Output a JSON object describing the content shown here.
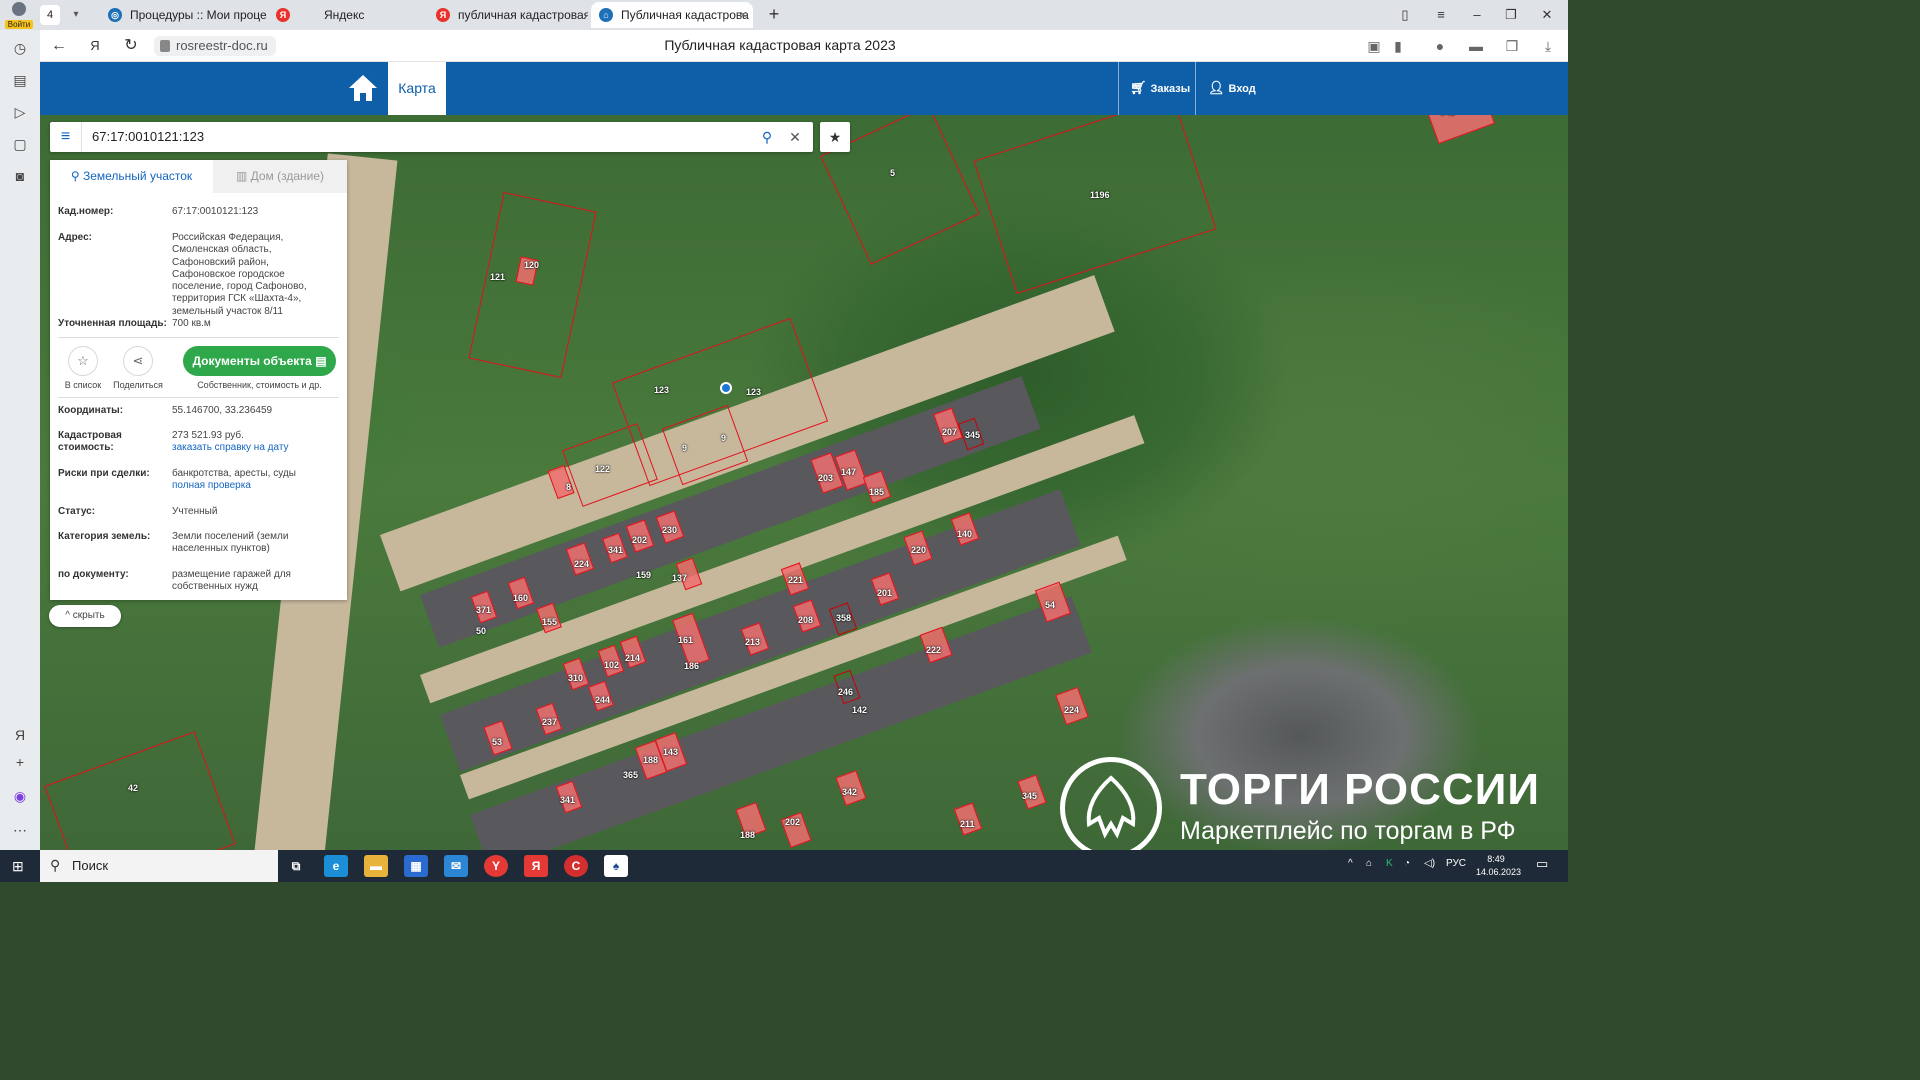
{
  "browser": {
    "profile_label": "Войти",
    "tab_count": "4",
    "tabs": [
      {
        "title": "Процедуры :: Мои проце",
        "active": false
      },
      {
        "title": "Яндекс",
        "active": false
      },
      {
        "title": "публичная кадастровая к",
        "active": false
      },
      {
        "title": "Публичная кадастрова",
        "active": true
      }
    ],
    "url": "rosreestr-doc.ru",
    "page_title": "Публичная кадастровая карта 2023"
  },
  "site": {
    "map_tab": "Карта",
    "orders": "Заказы",
    "login": "Вход"
  },
  "search": {
    "value": "67:17:0010121:123"
  },
  "panel": {
    "tab_land": "Земельный участок",
    "tab_house": "Дом (здание)",
    "fields": {
      "cad_label": "Кад.номер:",
      "cad_value": "67:17:0010121:123",
      "addr_label": "Адрес:",
      "addr_value": "Российская Федерация, Смоленская область, Сафоновский район, Сафоновское городское поселение, город Сафоново, территория ГСК «Шахта-4», земельный участок 8/11",
      "area_label": "Уточненная площадь:",
      "area_value": "700 кв.м",
      "coord_label": "Координаты:",
      "coord_value": "55.146700, 33.236459",
      "cost_label": "Кадастровая стоимость:",
      "cost_value": "273 521.93 руб.",
      "cost_link": "заказать справку на дату",
      "risk_label": "Риски при сделки:",
      "risk_value": "банкротства, аресты, суды",
      "risk_link": "полная проверка",
      "status_label": "Статус:",
      "status_value": "Учтенный",
      "cat_label": "Категория земель:",
      "cat_value": "Земли поселений (земли населенных пунктов)",
      "doc_label": "по документу:",
      "doc_value": "размещение гаражей для собственных нужд"
    },
    "actions": {
      "to_list": "В список",
      "share": "Поделиться",
      "docs_button": "Документы объекта",
      "docs_caption": "Собственник, стоимость и др."
    },
    "hide": "скрыть"
  },
  "map": {
    "parcel_labels": [
      "5",
      "1196",
      "121",
      "120",
      "123",
      "123",
      "9",
      "9",
      "122",
      "8",
      "42",
      "207",
      "345",
      "203",
      "147",
      "185",
      "220",
      "140",
      "221",
      "201",
      "54",
      "208",
      "358",
      "213",
      "222",
      "246",
      "142",
      "224",
      "224",
      "202",
      "230",
      "341",
      "159",
      "137",
      "371",
      "160",
      "155",
      "50",
      "161",
      "186",
      "102",
      "214",
      "310",
      "244",
      "237",
      "53",
      "188",
      "143",
      "365",
      "341",
      "342",
      "345",
      "188",
      "202",
      "211",
      "342"
    ]
  },
  "watermark": {
    "title": "ТОРГИ РОССИИ",
    "subtitle": "Маркетплейс по торгам в РФ"
  },
  "taskbar": {
    "search": "Поиск",
    "lang": "РУС",
    "time": "8:49",
    "date": "14.06.2023"
  },
  "colors": {
    "header_blue": "#0f5ea8",
    "link_blue": "#1565c0",
    "docs_green": "#2ea84a",
    "parcel_red": "#e3101b"
  }
}
